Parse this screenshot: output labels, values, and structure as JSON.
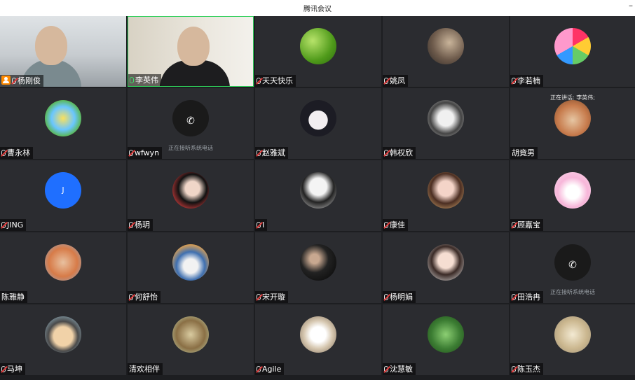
{
  "window": {
    "title": "腾讯会议",
    "minimize_glyph": "–"
  },
  "colors": {
    "active_border": "#2fcf5a",
    "tile_bg": "#2b2c30",
    "host_badge": "#ff8a00"
  },
  "participants": [
    {
      "name": "杨刚俊",
      "kind": "video",
      "host": true,
      "mic": "muted"
    },
    {
      "name": "李英伟",
      "kind": "video",
      "active": true,
      "mic": "on"
    },
    {
      "name": "天天快乐",
      "kind": "avatar",
      "mic": "muted",
      "avatar": "green-leaf"
    },
    {
      "name": "姚凤",
      "kind": "avatar",
      "mic": "muted",
      "avatar": "photo-woman"
    },
    {
      "name": "李若楠",
      "kind": "avatar",
      "mic": "muted",
      "avatar": "cartoon-rainbow"
    },
    {
      "name": "曹永林",
      "kind": "avatar",
      "mic": "muted",
      "avatar": "colorful-cartoon"
    },
    {
      "name": "wfwyn",
      "kind": "phone",
      "mic": "muted",
      "status": "正在接听系统电话"
    },
    {
      "name": "赵雅斌",
      "kind": "avatar",
      "mic": "muted",
      "avatar": "anime-face"
    },
    {
      "name": "韩权欣",
      "kind": "avatar",
      "mic": "muted",
      "avatar": "toy-figure"
    },
    {
      "name": "胡竟男",
      "kind": "avatar",
      "mic": "none",
      "avatar": "food-photo",
      "speaking": "正在讲话: 李英伟;"
    },
    {
      "name": "JING",
      "kind": "letter",
      "mic": "muted",
      "letter": "J"
    },
    {
      "name": "杨玥",
      "kind": "avatar",
      "mic": "muted",
      "avatar": "portrait-red"
    },
    {
      "name": "I",
      "kind": "avatar",
      "mic": "muted",
      "avatar": "portrait-gray"
    },
    {
      "name": "康佳",
      "kind": "avatar",
      "mic": "muted",
      "avatar": "portrait-girl"
    },
    {
      "name": "顾嘉宝",
      "kind": "avatar",
      "mic": "muted",
      "avatar": "pink-bunny"
    },
    {
      "name": "陈雅静",
      "kind": "avatar",
      "mic": "none",
      "avatar": "orange-painting"
    },
    {
      "name": "何舒怡",
      "kind": "avatar",
      "mic": "muted",
      "avatar": "blue-cat"
    },
    {
      "name": "宋开璇",
      "kind": "avatar",
      "mic": "muted",
      "avatar": "dark-photo"
    },
    {
      "name": "杨明娟",
      "kind": "avatar",
      "mic": "muted",
      "avatar": "portrait-light"
    },
    {
      "name": "田浩冉",
      "kind": "phone",
      "mic": "muted",
      "status": "正在接听系统电话"
    },
    {
      "name": "马坤",
      "kind": "avatar",
      "mic": "muted",
      "avatar": "cartoon-man"
    },
    {
      "name": "清欢相伴",
      "kind": "avatar",
      "mic": "none",
      "avatar": "outdoor-photo"
    },
    {
      "name": "Agile",
      "kind": "avatar",
      "mic": "muted",
      "avatar": "white-bird"
    },
    {
      "name": "沈慧敏",
      "kind": "avatar",
      "mic": "muted",
      "avatar": "green-bird"
    },
    {
      "name": "陈玉杰",
      "kind": "avatar",
      "mic": "muted",
      "avatar": "beige-photo"
    }
  ]
}
